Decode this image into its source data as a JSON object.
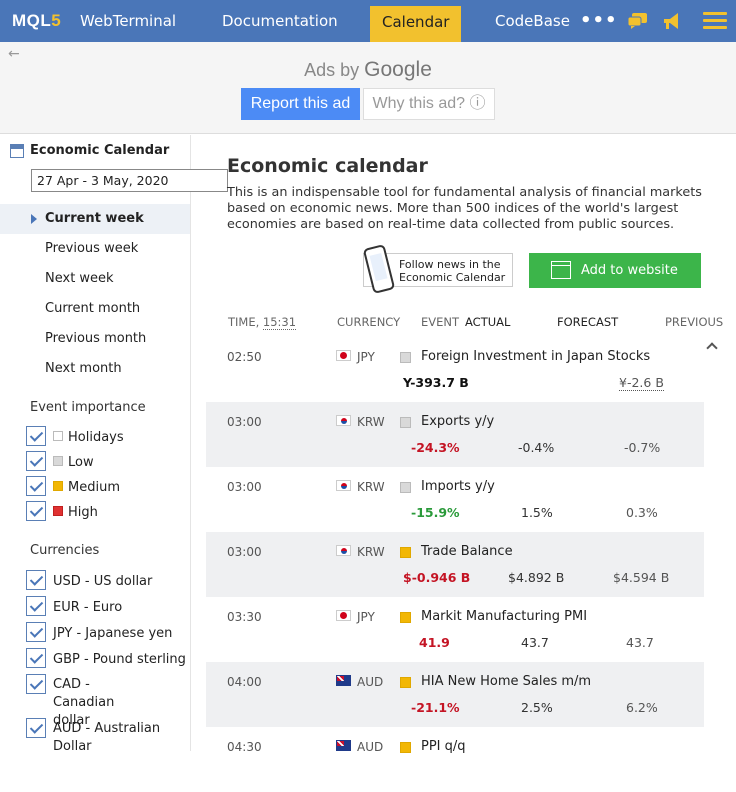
{
  "nav": {
    "logo_main": "MQL",
    "logo_five": "5",
    "items": [
      "WebTerminal",
      "Documentation",
      "Calendar",
      "CodeBase"
    ],
    "more": "•••",
    "accent": "#f2c12e",
    "bg": "#4a76b8"
  },
  "ads": {
    "back_icon": "arrow-left-icon",
    "ads_by": "Ads by",
    "google": "Google",
    "report": "Report this ad",
    "why": "Why this ad? ⓘ"
  },
  "sidebar": {
    "title": "Economic Calendar",
    "date_range": "27 Apr - 3 May, 2020",
    "periods": [
      "Current week",
      "Previous week",
      "Next week",
      "Current month",
      "Previous month",
      "Next month"
    ],
    "active_period": "Current week",
    "importance_title": "Event importance",
    "importance": [
      {
        "label": "Holidays",
        "color": "#ffffff"
      },
      {
        "label": "Low",
        "color": "#d9d9d9"
      },
      {
        "label": "Medium",
        "color": "#f2b705"
      },
      {
        "label": "High",
        "color": "#e03131"
      }
    ],
    "currencies_title": "Currencies",
    "currencies": [
      "USD - US dollar",
      "EUR - Euro",
      "JPY - Japanese yen",
      "GBP - Pound sterling",
      "CAD - Canadian dollar",
      "AUD - Australian Dollar"
    ]
  },
  "main": {
    "title": "Economic calendar",
    "description": "This is an indispensable tool for fundamental analysis of financial markets based on economic news. More than 500 indices of the world's largest economies are based on real-time data collected from public sources.",
    "follow_line1": "Follow news in the",
    "follow_line2": "Economic Calendar",
    "add_website": "Add to website",
    "headers": {
      "time": "TIME,",
      "time_value": "15:31",
      "currency": "CURRENCY",
      "event": "EVENT",
      "actual": "ACTUAL",
      "forecast": "FORECAST",
      "previous": "PREVIOUS"
    },
    "rows": [
      {
        "time": "02:50",
        "currency": "JPY",
        "flag": "jpy",
        "importance": "low",
        "event": "Foreign Investment in Japan Stocks",
        "actual": "Y-393.7 B",
        "actual_color": "black",
        "forecast": "",
        "previous": "¥-2.6 B"
      },
      {
        "time": "03:00",
        "currency": "KRW",
        "flag": "krw",
        "importance": "low",
        "event": "Exports y/y",
        "actual": "-24.3%",
        "actual_color": "red",
        "forecast": "-0.4%",
        "previous": "-0.7%"
      },
      {
        "time": "03:00",
        "currency": "KRW",
        "flag": "krw",
        "importance": "low",
        "event": "Imports y/y",
        "actual": "-15.9%",
        "actual_color": "green",
        "forecast": "1.5%",
        "previous": "0.3%"
      },
      {
        "time": "03:00",
        "currency": "KRW",
        "flag": "krw",
        "importance": "medium",
        "event": "Trade Balance",
        "actual": "$-0.946 B",
        "actual_color": "red",
        "forecast": "$4.892 B",
        "previous": "$4.594 B"
      },
      {
        "time": "03:30",
        "currency": "JPY",
        "flag": "jpy",
        "importance": "medium",
        "event": "Markit Manufacturing PMI",
        "actual": "41.9",
        "actual_color": "red",
        "forecast": "43.7",
        "previous": "43.7"
      },
      {
        "time": "04:00",
        "currency": "AUD",
        "flag": "aud",
        "importance": "medium",
        "event": "HIA New Home Sales m/m",
        "actual": "-21.1%",
        "actual_color": "red",
        "forecast": "2.5%",
        "previous": "6.2%"
      },
      {
        "time": "04:30",
        "currency": "AUD",
        "flag": "aud",
        "importance": "medium",
        "event": "PPI q/q",
        "actual": "",
        "actual_color": "black",
        "forecast": "",
        "previous": ""
      }
    ]
  }
}
